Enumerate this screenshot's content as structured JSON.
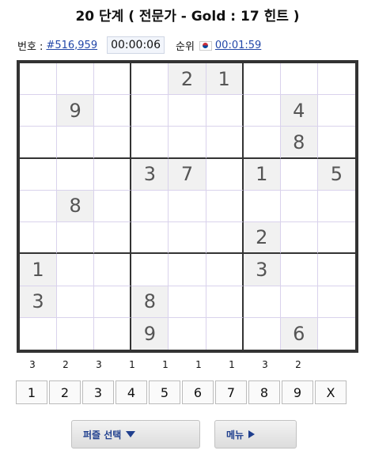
{
  "header": {
    "title": "20 단계 ( 전문가 - Gold : 17 힌트 )"
  },
  "info": {
    "number_label": "번호 :",
    "puzzle_number": "#516,959",
    "timer": "00:00:06",
    "rank_label": "순위",
    "flag_icon": "korea-flag-icon",
    "best_time": "00:01:59"
  },
  "board": {
    "rows": [
      [
        "",
        "",
        "",
        "",
        "2",
        "1",
        "",
        "",
        ""
      ],
      [
        "",
        "9",
        "",
        "",
        "",
        "",
        "",
        "4",
        ""
      ],
      [
        "",
        "",
        "",
        "",
        "",
        "",
        "",
        "8",
        ""
      ],
      [
        "",
        "",
        "",
        "3",
        "7",
        "",
        "1",
        "",
        "5"
      ],
      [
        "",
        "8",
        "",
        "",
        "",
        "",
        "",
        "",
        ""
      ],
      [
        "",
        "",
        "",
        "",
        "",
        "",
        "2",
        "",
        ""
      ],
      [
        "1",
        "",
        "",
        "",
        "",
        "",
        "3",
        "",
        ""
      ],
      [
        "3",
        "",
        "",
        "8",
        "",
        "",
        "",
        "",
        ""
      ],
      [
        "",
        "",
        "",
        "9",
        "",
        "",
        "",
        "6",
        ""
      ]
    ]
  },
  "counts": [
    "3",
    "2",
    "3",
    "1",
    "1",
    "1",
    "1",
    "3",
    "2"
  ],
  "numpad": [
    "1",
    "2",
    "3",
    "4",
    "5",
    "6",
    "7",
    "8",
    "9",
    "X"
  ],
  "buttons": {
    "puzzle_select": "퍼즐 선택",
    "menu": "메뉴"
  }
}
